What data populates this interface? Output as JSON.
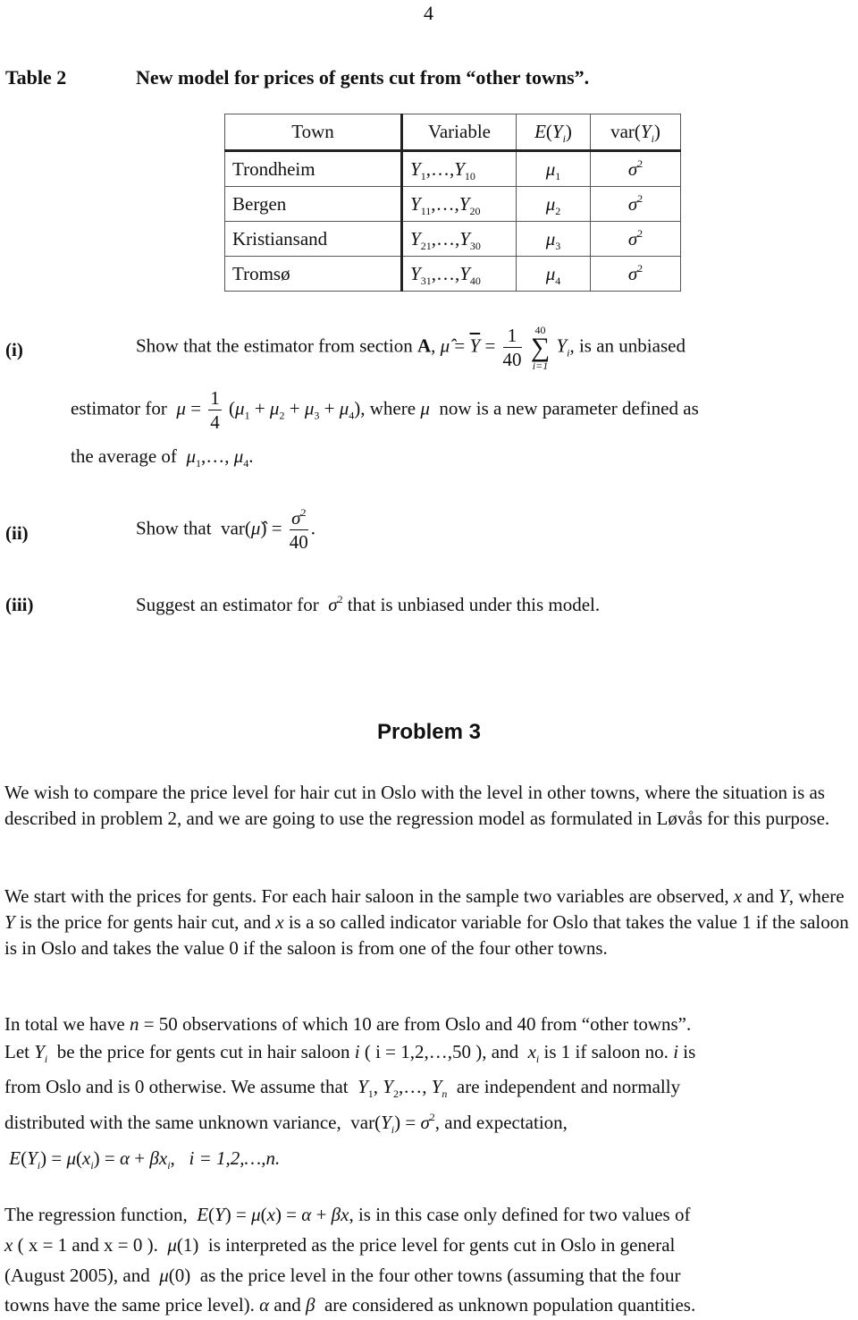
{
  "page": {
    "number": "4"
  },
  "table": {
    "label": "Table 2",
    "title": "New model for prices of gents cut from “other towns”.",
    "headers": {
      "town": "Town",
      "variable": "Variable",
      "expectation": "E(Yᵢ)",
      "variance": "var(Yᵢ)"
    },
    "rows": [
      {
        "town": "Trondheim",
        "var_from": "1",
        "var_to": "10",
        "mu": "1",
        "sigma": "σ²"
      },
      {
        "town": "Bergen",
        "var_from": "11",
        "var_to": "20",
        "mu": "2",
        "sigma": "σ²"
      },
      {
        "town": "Kristiansand",
        "var_from": "21",
        "var_to": "30",
        "mu": "3",
        "sigma": "σ²"
      },
      {
        "town": "Tromsø",
        "var_from": "31",
        "var_to": "40",
        "mu": "4",
        "sigma": "σ²"
      }
    ]
  },
  "questions": {
    "i": {
      "label": "(i)",
      "text1": "Show that the estimator from section ",
      "section": "A",
      "text2": ", is an unbiased",
      "line2_a": "estimator for",
      "line2_b": ", where",
      "line2_c": "now is a new parameter defined as",
      "line3": "the average of",
      "sum_denominator": "40",
      "sum_upper": "40",
      "sum_lower": "i=1"
    },
    "ii": {
      "label": "(ii)",
      "text": "Show that",
      "denominator": "40"
    },
    "iii": {
      "label": "(iii)",
      "text1": "Suggest an estimator for",
      "text2": "that is unbiased under this model."
    }
  },
  "problem3": {
    "heading": "Problem 3",
    "p1": "We wish to compare the price level for hair cut in Oslo with the level in other towns, where the situation is as described in problem 2, and we are going to use the regression model as formulated in Løvås for this purpose.",
    "p2_a": "We start with the prices for gents. For each hair saloon in the sample two variables are observed, ",
    "p2_b": " and ",
    "p2_c": ", where ",
    "p2_d": " is the price for gents hair cut, and ",
    "p2_e": " is a so called indicator variable for Oslo that takes the value 1 if the saloon is in Oslo and takes the value 0 if the saloon is from one of the four other towns.",
    "p3_l1a": "In total we have",
    "p3_n": "n = 50",
    "p3_l1b": "observations of which 10 are from Oslo and 40 from “other towns”.",
    "p3_l2a": "Let",
    "p3_l2b": "be the price for gents cut in hair saloon",
    "p3_l2c": "( i = 1,2,…,50 ), and",
    "p3_l2d": "is 1 if saloon no.",
    "p3_l2e": "is",
    "p3_l3a": "from Oslo and is 0 otherwise. We assume that",
    "p3_l3b": "are independent and normally",
    "p3_l4a": "distributed with the same unknown variance,",
    "p3_l4b": ", and expectation,",
    "p3_l5": "i = 1,2,…,n.",
    "p4_l1a": "The regression function,",
    "p4_l1b": ", is in this case only defined for two values of",
    "p4_l2a": "( x = 1 and x = 0 ).",
    "p4_l2b": "is interpreted as the price level for gents cut in Oslo in general",
    "p4_l3a": "(August 2005), and",
    "p4_l3b": "as the price level in the four other towns (assuming that the four",
    "p4_l4a": "towns have the same price level).",
    "p4_l4b": "and",
    "p4_l4c": "are considered as unknown population quantities."
  }
}
